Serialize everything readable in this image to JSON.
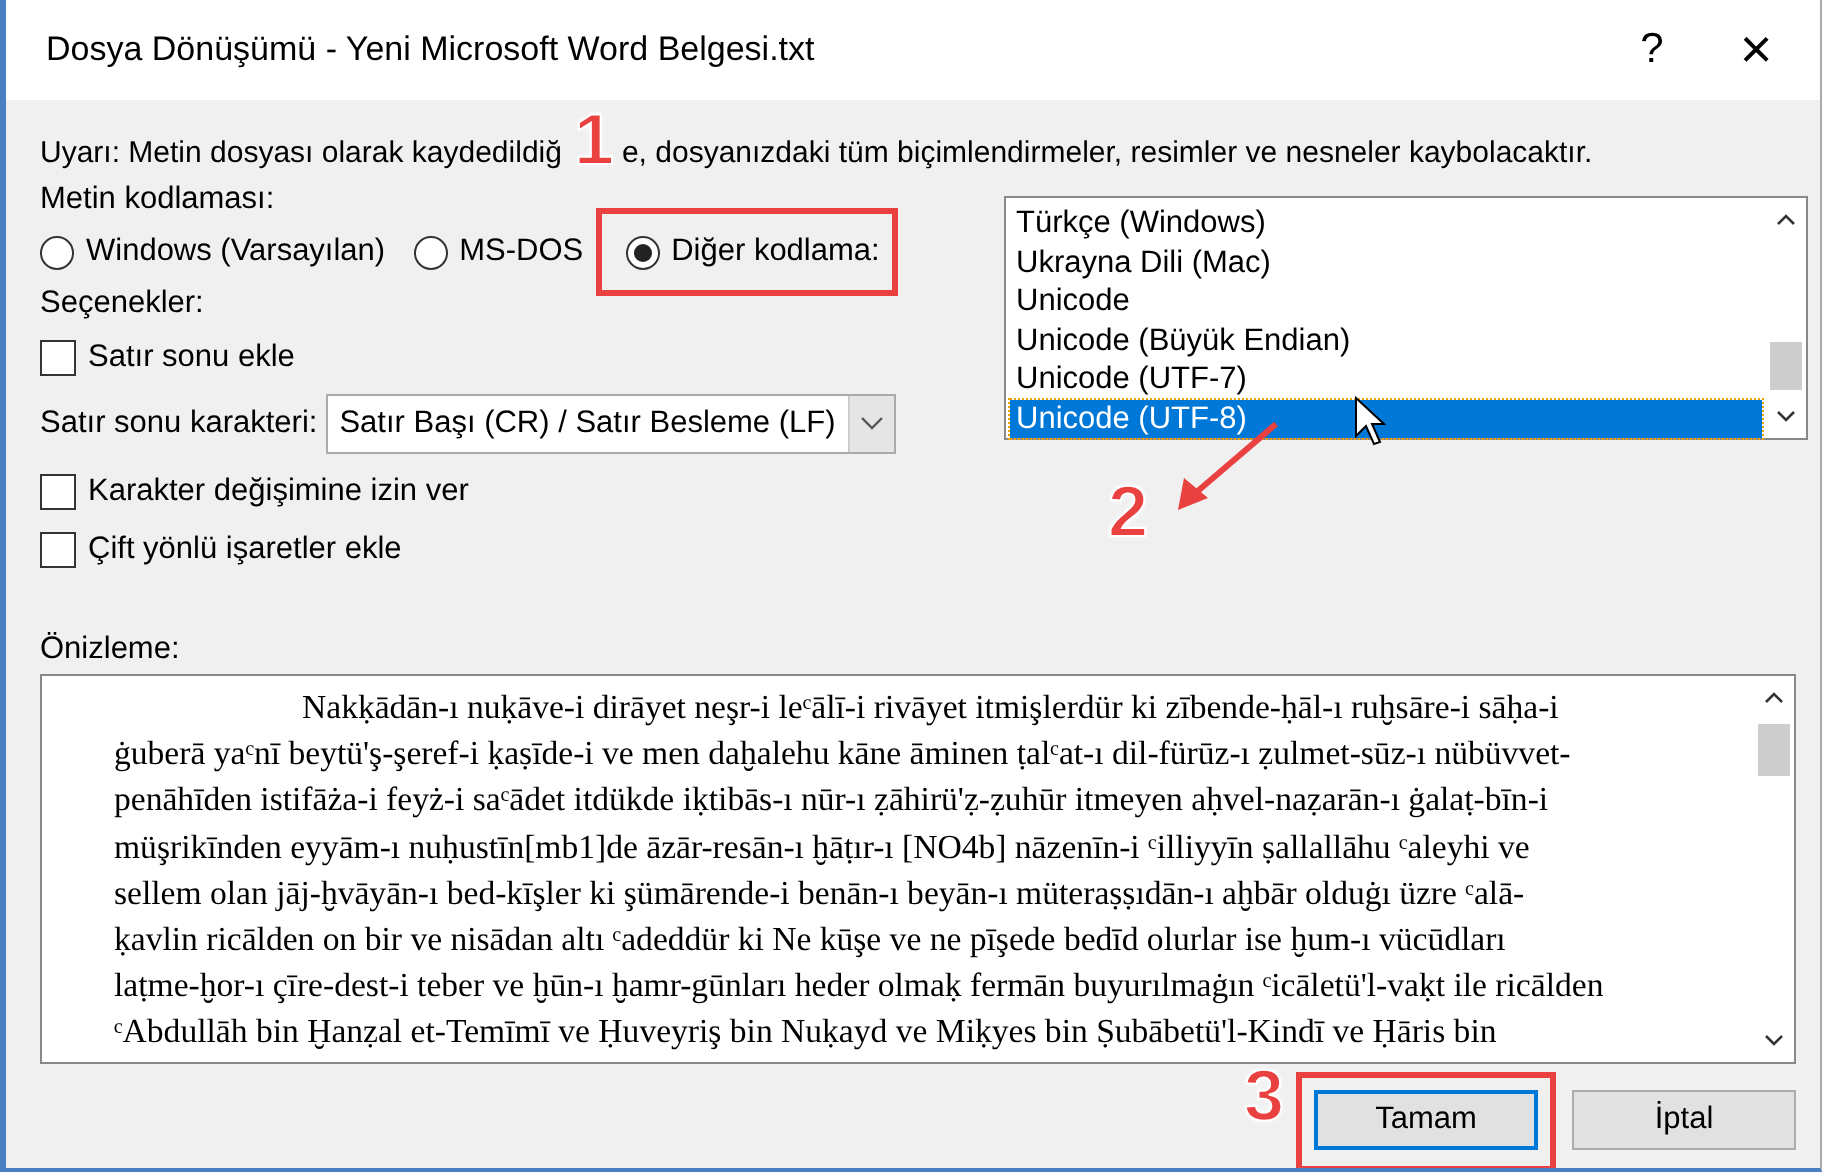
{
  "window": {
    "title": "Dosya Dönüşümü - Yeni Microsoft Word Belgesi.txt",
    "help": "?",
    "close": "×"
  },
  "warning": [
    "Uyarı: Metin dosyası olarak kaydedildiğ",
    "e, dosyanızdaki tüm biçimlendirmeler, resimler ve nesneler kaybolacaktır."
  ],
  "encoding_label": "Metin kodlaması:",
  "radios": [
    {
      "label": "Windows (Varsayılan)",
      "selected": false
    },
    {
      "label": "MS-DOS",
      "selected": false
    },
    {
      "label": "Diğer kodlama:",
      "selected": true
    }
  ],
  "options_label": "Seçenekler:",
  "checkboxes_top": [
    {
      "label": "Satır sonu ekle",
      "checked": false
    }
  ],
  "line_ending": {
    "label": "Satır sonu karakteri:",
    "value": "Satır Başı (CR) / Satır Besleme (LF)"
  },
  "checkboxes_bottom": [
    {
      "label": "Karakter değişimine izin ver",
      "checked": false
    },
    {
      "label": "Çift yönlü işaretler ekle",
      "checked": false
    }
  ],
  "encodings": [
    {
      "label": "Türkçe (Windows)",
      "selected": false
    },
    {
      "label": "Ukrayna Dili (Mac)",
      "selected": false
    },
    {
      "label": "Unicode",
      "selected": false
    },
    {
      "label": "Unicode (Büyük Endian)",
      "selected": false
    },
    {
      "label": "Unicode (UTF-7)",
      "selected": false
    },
    {
      "label": "Unicode (UTF-8)",
      "selected": true
    }
  ],
  "preview": {
    "label": "Önizleme:",
    "lines": [
      "Nakḳādān-ı nuḳāve-i dirāyet neşr-i  leᶜālī-i rivāyet itmişlerdür ki zībende-ḥāl-ı ruḫsāre-i sāḥa-i",
      "ġuberā yaᶜnī beytü'ş-şeref-i ḳaṣīde-i ve men daḫalehu kāne āminen  ṭalᶜat-ı dil-fürūz-ı ẓulmet-sūz-ı nübüvvet-",
      "penāhīden istifāża-i feyż-i saᶜādet itdükde iḳtibās-ı nūr-ı ẓāhirü'ẓ-ẓuhūr itmeyen aḥvel-naẓarān-ı ġalaṭ-bīn-i",
      "müşrikīnden eyyām-ı nuḥustīn[mb1]de āzār-resān-ı ḫāṭır-ı [NO4b] nāzenīn-i ᶜilliyyīn ṣallallāhu ᶜaleyhi ve",
      "sellem olan jāj-ḫvāyān-ı  bed-kīşler ki şümārende-i benān-ı beyān-ı müteraṣṣıdān-ı aḫbār olduġı üzre ᶜalā-",
      "ḳavlin ricālden on bir ve  nisādan altı ᶜadeddür ki  Ne kūşe ve ne pīşede  bedīd olurlar ise ḫum-ı vücūdları",
      "laṭme-ḫor-ı çīre-dest-i teber ve ḫūn-ı ḫamr-gūnları heder olmaḳ fermān buyurılmaġın ᶜicāletü'l-vaḳt  ile ricālden",
      "ᶜAbdullāh bin Ḫanẓal  et-Temīmī ve Ḥuveyriş bin Nuḳayd ve Miḳyes bin Ṣubābetü'l-Kindī  ve Ḥāris bin"
    ]
  },
  "buttons": [
    {
      "label": "Tamam",
      "default": true
    },
    {
      "label": "İptal",
      "default": false
    }
  ],
  "annotations": [
    "1",
    "2",
    "3"
  ]
}
